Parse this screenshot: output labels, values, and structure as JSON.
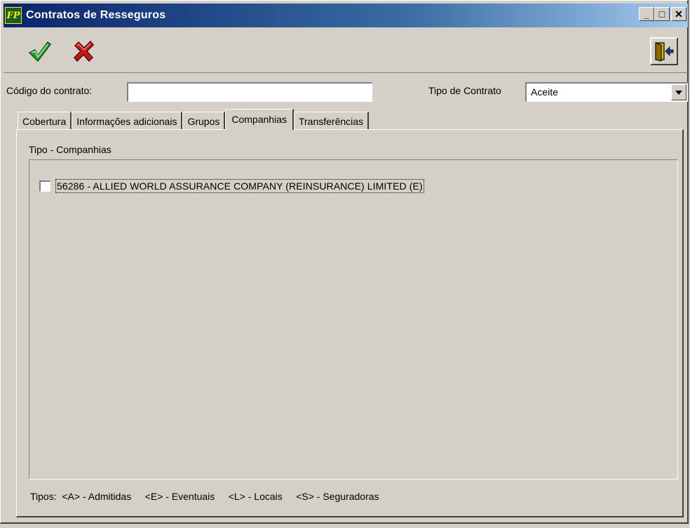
{
  "window": {
    "title": "Contratos de Resseguros",
    "app_icon_text": "FP",
    "controls": {
      "minimize": "_",
      "maximize": "□",
      "close": "✕"
    }
  },
  "toolbar": {
    "confirm_icon": "check-icon",
    "cancel_icon": "x-icon",
    "exit_icon": "exit-door-icon",
    "confirm_color": "#2e9d2e",
    "cancel_color": "#c41a1a"
  },
  "form": {
    "codigo_label": "Código do contrato:",
    "codigo_value": "",
    "tipo_label": "Tipo de Contrato",
    "tipo_value": "Aceite"
  },
  "tabs": [
    {
      "label": "Cobertura",
      "active": false
    },
    {
      "label": "Informações adicionais",
      "active": false
    },
    {
      "label": "Grupos",
      "active": false
    },
    {
      "label": "Companhias",
      "active": true
    },
    {
      "label": "Transferências",
      "active": false
    }
  ],
  "companhias": {
    "group_label": "Tipo - Companhias",
    "items": [
      {
        "text": "56286  -  ALLIED WORLD ASSURANCE COMPANY (REINSURANCE) LIMITED (E)",
        "checked": false
      }
    ],
    "legend": "Tipos:  <A> - Admitidas     <E> - Eventuais     <L> - Locais     <S> - Seguradoras"
  }
}
